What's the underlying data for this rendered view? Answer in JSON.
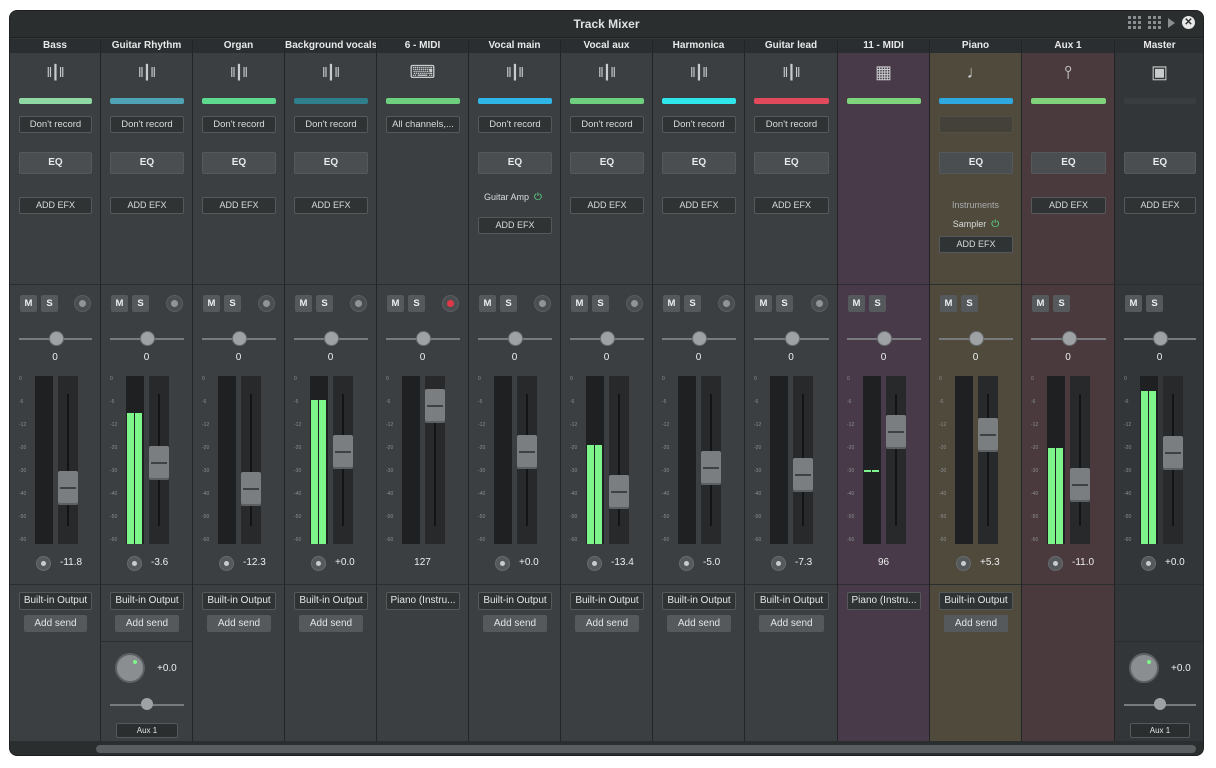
{
  "window": {
    "title": "Track Mixer"
  },
  "toolbar_icons": [
    "grid-view-icon",
    "tile-view-icon",
    "play-icon",
    "close-icon"
  ],
  "tracks": [
    {
      "name": "Bass",
      "icon": "waveform-icon",
      "color": "#8fd8a4",
      "record": "Don't record",
      "efx": "ADD EFX",
      "pan": "0",
      "volume": "-11.8",
      "output": "Built-in Output",
      "send": "Add send",
      "meter": 0,
      "fader": 0.71
    },
    {
      "name": "Guitar Rhythm",
      "icon": "waveform-icon",
      "color": "#4fa2b4",
      "record": "Don't record",
      "efx": "ADD EFX",
      "pan": "0",
      "volume": "-3.6",
      "output": "Built-in Output",
      "send": "Add send",
      "meter": 0.78,
      "peak": 0.77,
      "fader": 0.52,
      "aux_value": "+0.0",
      "aux_name": "Aux 1"
    },
    {
      "name": "Organ",
      "icon": "waveform-icon",
      "color": "#5fd890",
      "record": "Don't record",
      "efx": "ADD EFX",
      "pan": "0",
      "volume": "-12.3",
      "output": "Built-in Output",
      "send": "Add send",
      "meter": 0,
      "fader": 0.72
    },
    {
      "name": "Background vocals",
      "icon": "waveform-icon",
      "color": "#2f7e8c",
      "record": "Don't record",
      "efx": "ADD EFX",
      "pan": "0",
      "volume": "+0.0",
      "output": "Built-in Output",
      "send": "Add send",
      "meter": 0.85,
      "peak": 0.86,
      "fader": 0.44
    },
    {
      "name": "6 - MIDI",
      "icon": "keyboard-icon",
      "color": "#6ed07e",
      "record": "All channels,...",
      "pan": "0",
      "volume": "127",
      "output": "Piano (Instru...",
      "meter": 0,
      "fader": 0.1
    },
    {
      "name": "Vocal main",
      "icon": "waveform-icon",
      "color": "#2fb6e6",
      "record": "Don't record",
      "plugin": "Guitar Amp",
      "efx": "ADD EFX",
      "pan": "0",
      "volume": "+0.0",
      "output": "Built-in Output",
      "send": "Add send",
      "meter": 0,
      "fader": 0.44
    },
    {
      "name": "Vocal aux",
      "icon": "waveform-icon",
      "color": "#6ed07e",
      "record": "Don't record",
      "efx": "ADD EFX",
      "pan": "0",
      "volume": "-13.4",
      "output": "Built-in Output",
      "send": "Add send",
      "meter": 0.58,
      "peak": 0.59,
      "fader": 0.74
    },
    {
      "name": "Harmonica",
      "icon": "waveform-icon",
      "color": "#2ee6ec",
      "record": "Don't record",
      "efx": "ADD EFX",
      "pan": "0",
      "volume": "-5.0",
      "output": "Built-in Output",
      "send": "Add send",
      "meter": 0,
      "fader": 0.56
    },
    {
      "name": "Guitar lead",
      "icon": "waveform-icon",
      "color": "#e04a5c",
      "record": "Don't record",
      "efx": "ADD EFX",
      "pan": "0",
      "volume": "-7.3",
      "output": "Built-in Output",
      "send": "Add send",
      "meter": 0,
      "fader": 0.61
    },
    {
      "name": "11 - MIDI",
      "icon": "drum-machine-icon",
      "color": "#7fd37a",
      "pan": "0",
      "volume": "96",
      "output": "Piano (Instru...",
      "meter": 0,
      "peak": 0.44,
      "fader": 0.29
    },
    {
      "name": "Piano",
      "icon": "music-note-icon",
      "color": "#2fa8e0",
      "instruments_label": "Instruments",
      "plugin": "Sampler",
      "efx": "ADD EFX",
      "pan": "0",
      "volume": "+5.3",
      "output": "Built-in Output",
      "send": "Add send",
      "meter": 0,
      "fader": 0.31
    },
    {
      "name": "Aux 1",
      "icon": "bus-icon",
      "color": "#7fd37a",
      "efx": "ADD EFX",
      "pan": "0",
      "volume": "-11.0",
      "output": "",
      "meter": 0.56,
      "peak": 0.57,
      "fader": 0.69
    },
    {
      "name": "Master",
      "icon": "speaker-icon",
      "color": "#3a3d3f",
      "efx": "ADD EFX",
      "pan": "0",
      "volume": "+0.0",
      "meter": 0.9,
      "peak": 0.91,
      "fader": 0.45,
      "aux_value": "+0.0",
      "aux_name": "Aux 1"
    }
  ],
  "labels": {
    "eq": "EQ",
    "mute": "M",
    "solo": "S"
  },
  "meter_scale": [
    "0",
    "-6",
    "-12",
    "-20",
    "-30",
    "-40",
    "-50",
    "-60"
  ]
}
